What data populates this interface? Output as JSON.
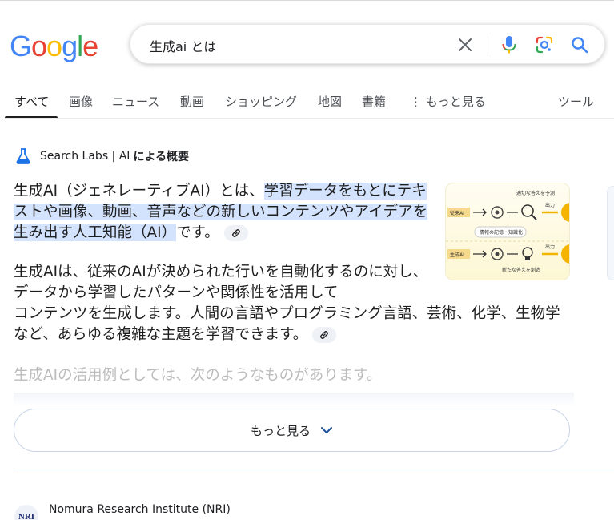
{
  "logo": {
    "letters": [
      "G",
      "o",
      "o",
      "g",
      "l",
      "e"
    ],
    "colors": [
      "#4285F4",
      "#EA4335",
      "#FBBC05",
      "#4285F4",
      "#34A853",
      "#EA4335"
    ]
  },
  "search": {
    "query": "生成ai とは",
    "icons": [
      "close-icon",
      "microphone-icon",
      "google-lens-icon",
      "search-icon"
    ]
  },
  "tabs": [
    {
      "label": "すべて",
      "active": true
    },
    {
      "label": "画像"
    },
    {
      "label": "ニュース"
    },
    {
      "label": "動画"
    },
    {
      "label": "ショッピング"
    },
    {
      "label": "地図"
    },
    {
      "label": "書籍"
    },
    {
      "label": "もっと見る",
      "prefix": "⋮"
    },
    {
      "label": "ツール"
    }
  ],
  "ai_overview": {
    "labs_label": "Search Labs | AI",
    "labs_suffix": "による概要",
    "para1_plain": "生成AI（ジェネレーティブAI）とは、",
    "para1_highlight": "学習データをもとにテキストや画像、動画、音声などの新しいコンテンツやアイデアを生み出す人工知能（AI）",
    "para1_tail": "です。",
    "para2_line1": "生成AIは、従来のAIが決められた行いを自動化するのに対し、データから学習したパターンや関係性を活用して",
    "para2_rest": "コンテンツを生成します。人間の言語やプログラミング言語、芸術、化学、生物学など、あらゆる複雑な主題を学習できます。",
    "para3": "生成AIの活用例としては、次のようなものがあります。",
    "more_label": "もっと見る",
    "thumbnail": {
      "top_label": "適切な答えを予測",
      "row1_label": "従来AI",
      "row1_out": "出力",
      "middle_label": "情報の記憶・知識化",
      "row2_label": "生成AI",
      "row2_out": "出力",
      "bottom_label": "新たな答えを創造"
    }
  },
  "result": {
    "logo_text": "NRI",
    "source": "Nomura Research Institute (NRI)"
  }
}
